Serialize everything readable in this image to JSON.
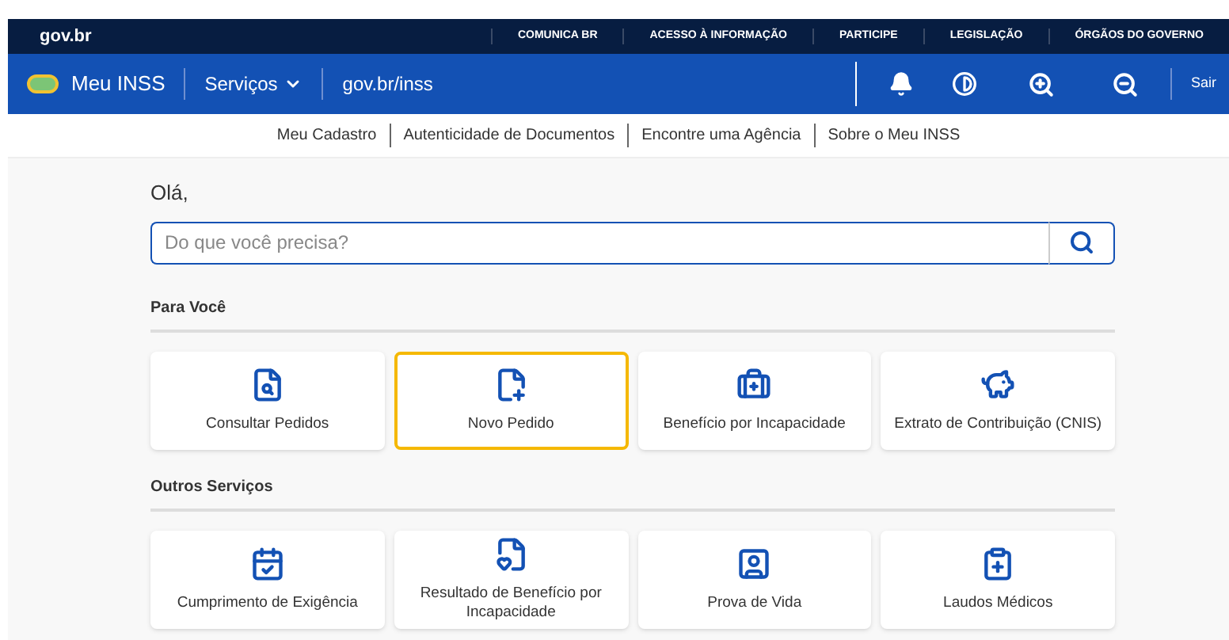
{
  "top_bar": {
    "logo": "gov.br",
    "links": [
      "COMUNICA BR",
      "ACESSO À INFORMAÇÃO",
      "PARTICIPE",
      "LEGISLAÇÃO",
      "ÓRGÃOS DO GOVERNO"
    ]
  },
  "header": {
    "title": "Meu INSS",
    "menu": "Serviços",
    "url": "gov.br/inss",
    "logout": "Sair"
  },
  "subnav": [
    "Meu Cadastro",
    "Autenticidade de Documentos",
    "Encontre uma Agência",
    "Sobre o Meu INSS"
  ],
  "greeting": "Olá,",
  "search": {
    "placeholder": "Do que você precisa?"
  },
  "sections": [
    {
      "title": "Para Você",
      "cards": [
        {
          "label": "Consultar Pedidos",
          "selected": false
        },
        {
          "label": "Novo Pedido",
          "selected": true
        },
        {
          "label": "Benefício por Incapacidade",
          "selected": false
        },
        {
          "label": "Extrato de Contribuição (CNIS)",
          "selected": false
        }
      ]
    },
    {
      "title": "Outros Serviços",
      "cards": [
        {
          "label": "Cumprimento de Exigência",
          "selected": false
        },
        {
          "label": "Resultado de Benefício por Incapacidade",
          "selected": false
        },
        {
          "label": "Prova de Vida",
          "selected": false
        },
        {
          "label": "Laudos Médicos",
          "selected": false
        }
      ]
    }
  ]
}
